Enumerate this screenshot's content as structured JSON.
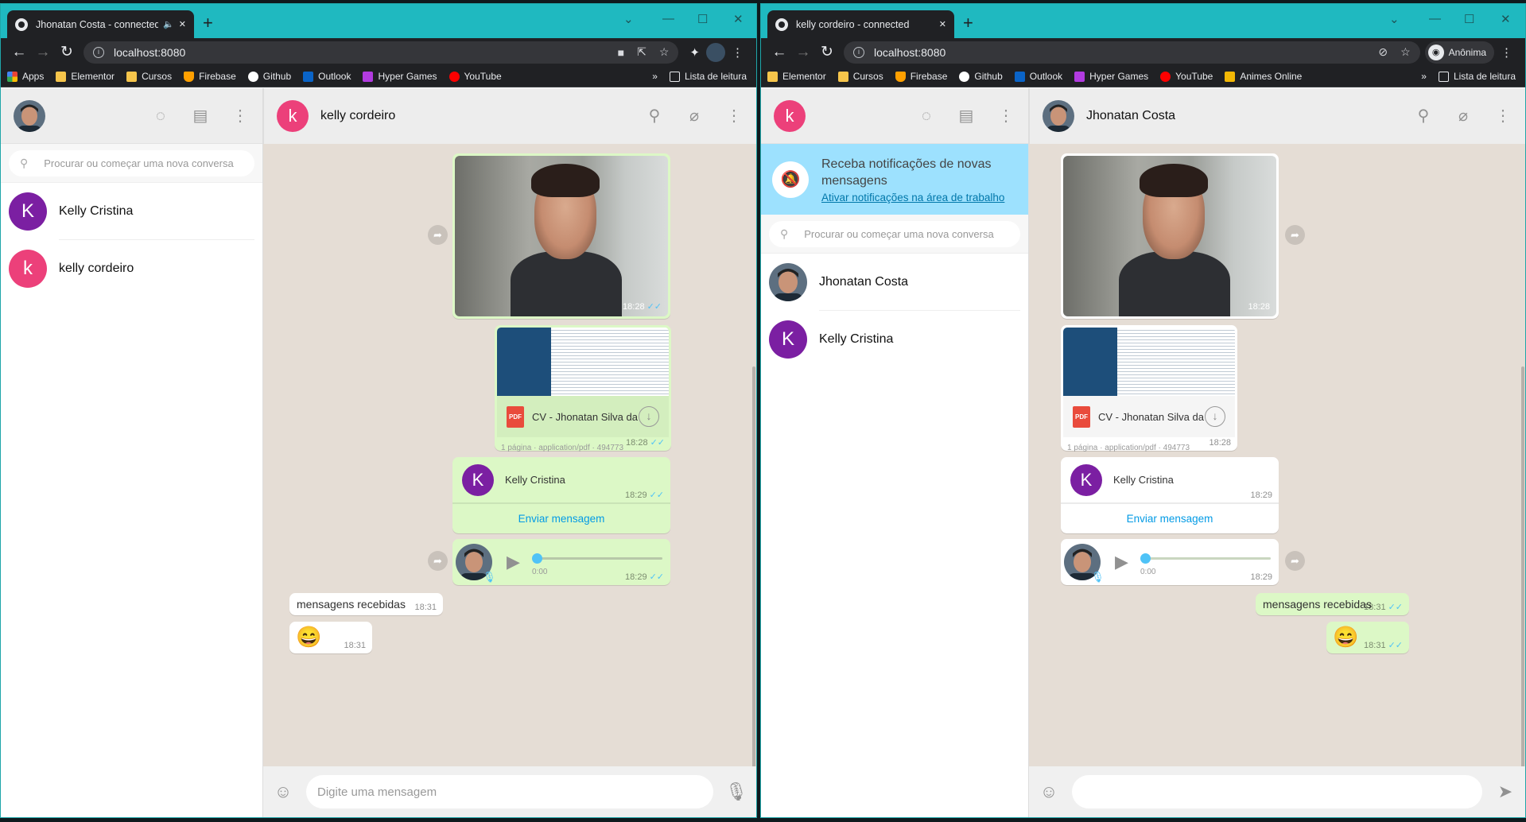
{
  "windowA": {
    "tab_title": "Jhonatan Costa - connected",
    "url": "localhost:8080",
    "bookmarks": [
      "Apps",
      "Elementor",
      "Cursos",
      "Firebase",
      "Github",
      "Outlook",
      "Hyper Games",
      "YouTube"
    ],
    "reading_list": "Lista de leitura",
    "search_placeholder": "Procurar ou começar uma nova conversa",
    "contacts": [
      {
        "initial": "K",
        "name": "Kelly Cristina",
        "color": "#7b1fa2"
      },
      {
        "initial": "k",
        "name": "kelly cordeiro",
        "color": "#ec407a"
      }
    ],
    "chat": {
      "initial": "k",
      "name": "kelly cordeiro",
      "color": "#ec407a",
      "photo_time": "18:28",
      "doc_name": "CV - Jhonatan Silva da...",
      "doc_meta": "1 página · application/pdf · 494773",
      "doc_time": "18:28",
      "card_initial": "K",
      "card_name": "Kelly Cristina",
      "card_time": "18:29",
      "card_action": "Enviar mensagem",
      "audio_duration": "0:00",
      "audio_time": "18:29",
      "text_msg": "mensagens recebidas",
      "text_time": "18:31",
      "emoji": "😄",
      "emoji_time": "18:31"
    },
    "compose_placeholder": "Digite uma mensagem"
  },
  "windowB": {
    "tab_title": "kelly cordeiro - connected",
    "url": "localhost:8080",
    "profile": "Anônima",
    "bookmarks": [
      "Elementor",
      "Cursos",
      "Firebase",
      "Github",
      "Outlook",
      "Hyper Games",
      "YouTube",
      "Animes Online"
    ],
    "reading_list": "Lista de leitura",
    "me_initial": "k",
    "notification_title": "Receba notificações de novas mensagens",
    "notification_link": "Ativar notificações na área de trabalho",
    "search_placeholder": "Procurar ou começar uma nova conversa",
    "contacts": [
      {
        "initial": "",
        "name": "Jhonatan Costa",
        "color": "#3a4f63"
      },
      {
        "initial": "K",
        "name": "Kelly Cristina",
        "color": "#7b1fa2"
      }
    ],
    "chat": {
      "name": "Jhonatan Costa",
      "photo_time": "18:28",
      "doc_name": "CV - Jhonatan Silva da...",
      "doc_meta": "1 página · application/pdf · 494773",
      "doc_time": "18:28",
      "card_initial": "K",
      "card_name": "Kelly Cristina",
      "card_time": "18:29",
      "card_action": "Enviar mensagem",
      "audio_duration": "0:00",
      "audio_time": "18:29",
      "text_msg": "mensagens recebidas",
      "text_time": "18:31",
      "emoji": "😄",
      "emoji_time": "18:31"
    }
  },
  "colors": {
    "accent": "#1fb9c0",
    "outgoing": "#dcf8c6",
    "incoming": "#ffffff",
    "chat_bg": "#e5ddd5",
    "notif": "#9de1fe"
  }
}
